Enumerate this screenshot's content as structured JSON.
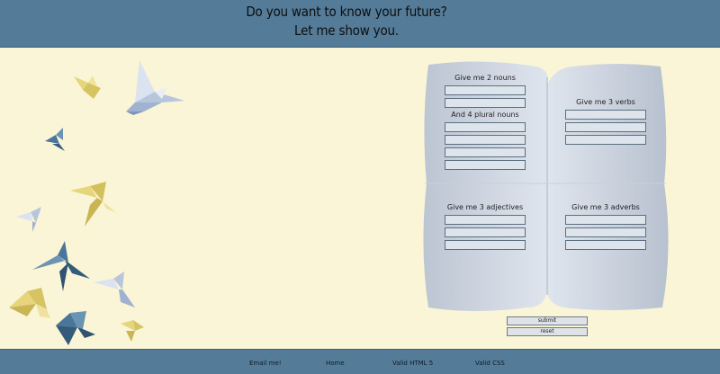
{
  "header": {
    "line1": "Do you want to know your future?",
    "line2": "Let me show you."
  },
  "fortune": {
    "nouns_label": "Give me 2 nouns",
    "plural_label": "And 4 plural nouns",
    "verbs_label": "Give me 3 verbs",
    "adjectives_label": "Give me 3 adjectives",
    "adverbs_label": "Give me 3 adverbs"
  },
  "buttons": {
    "submit": "submit",
    "reset": "reset"
  },
  "footer": {
    "email": "Email me!",
    "home": "Home",
    "html": "Valid HTML 5",
    "css": "Valid CSS"
  },
  "colors": {
    "header_bg": "#547c99",
    "page_bg": "#faf5d6",
    "bird_yellow": "#e6d57a",
    "bird_blue": "#4a7699",
    "bird_light": "#c8d4e6"
  }
}
